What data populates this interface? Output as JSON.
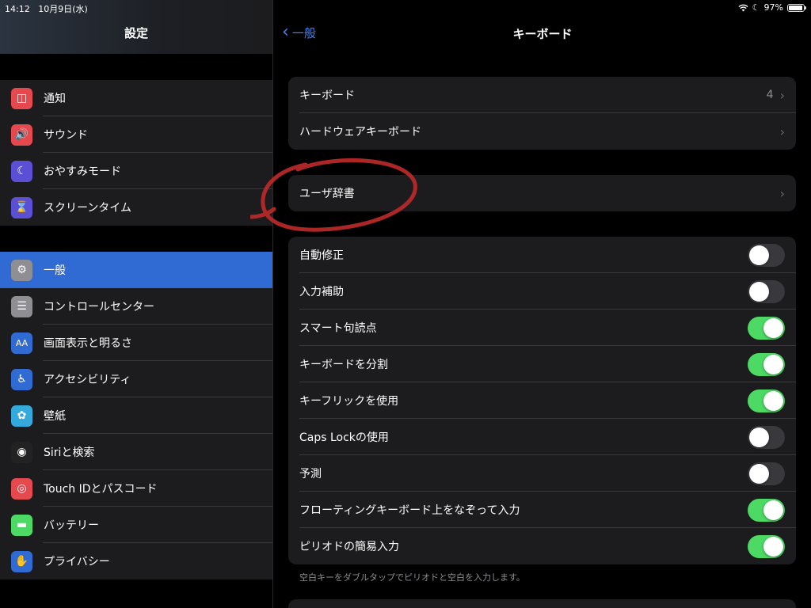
{
  "status": {
    "time": "14:12",
    "date": "10月9日(水)",
    "battery": "97%",
    "battery_level": 0.97
  },
  "sidebar": {
    "title": "設定",
    "groups": [
      [
        {
          "label": "通知",
          "icon": "notification-icon",
          "color": "#e5484d"
        },
        {
          "label": "サウンド",
          "icon": "speaker-icon",
          "color": "#e5484d"
        },
        {
          "label": "おやすみモード",
          "icon": "moon-icon",
          "color": "#5b4fd6"
        },
        {
          "label": "スクリーンタイム",
          "icon": "hourglass-icon",
          "color": "#5b4fd6"
        }
      ],
      [
        {
          "label": "一般",
          "icon": "gear-icon",
          "color": "#8e8e93",
          "selected": true
        },
        {
          "label": "コントロールセンター",
          "icon": "toggles-icon",
          "color": "#8e8e93"
        },
        {
          "label": "画面表示と明るさ",
          "icon": "text-size-icon",
          "color": "#2f6bd2"
        },
        {
          "label": "アクセシビリティ",
          "icon": "accessibility-icon",
          "color": "#2f6bd2"
        },
        {
          "label": "壁紙",
          "icon": "flower-icon",
          "color": "#34aadc"
        },
        {
          "label": "Siriと検索",
          "icon": "siri-icon",
          "color": "#222"
        },
        {
          "label": "Touch IDとパスコード",
          "icon": "fingerprint-icon",
          "color": "#e5484d"
        },
        {
          "label": "バッテリー",
          "icon": "battery-icon",
          "color": "#4cd964"
        },
        {
          "label": "プライバシー",
          "icon": "hand-icon",
          "color": "#2f6bd2"
        }
      ]
    ]
  },
  "main": {
    "back_label": "一般",
    "title": "キーボード",
    "group1": [
      {
        "label": "キーボード",
        "value": "4"
      },
      {
        "label": "ハードウェアキーボード",
        "value": ""
      }
    ],
    "group2": [
      {
        "label": "ユーザ辞書"
      }
    ],
    "toggles": [
      {
        "label": "自動修正",
        "on": false
      },
      {
        "label": "入力補助",
        "on": false
      },
      {
        "label": "スマート句読点",
        "on": true
      },
      {
        "label": "キーボードを分割",
        "on": true
      },
      {
        "label": "キーフリックを使用",
        "on": true
      },
      {
        "label": "Caps Lockの使用",
        "on": false
      },
      {
        "label": "予測",
        "on": false
      },
      {
        "label": "フローティングキーボード上をなぞって入力",
        "on": true
      },
      {
        "label": "ピリオドの簡易入力",
        "on": true
      }
    ],
    "footnote": "空白キーをダブルタップでピリオドと空白を入力します。"
  },
  "colors": {
    "accent": "#3b82f6",
    "toggle_on": "#4cd964",
    "annotation": "#c02a2a"
  }
}
